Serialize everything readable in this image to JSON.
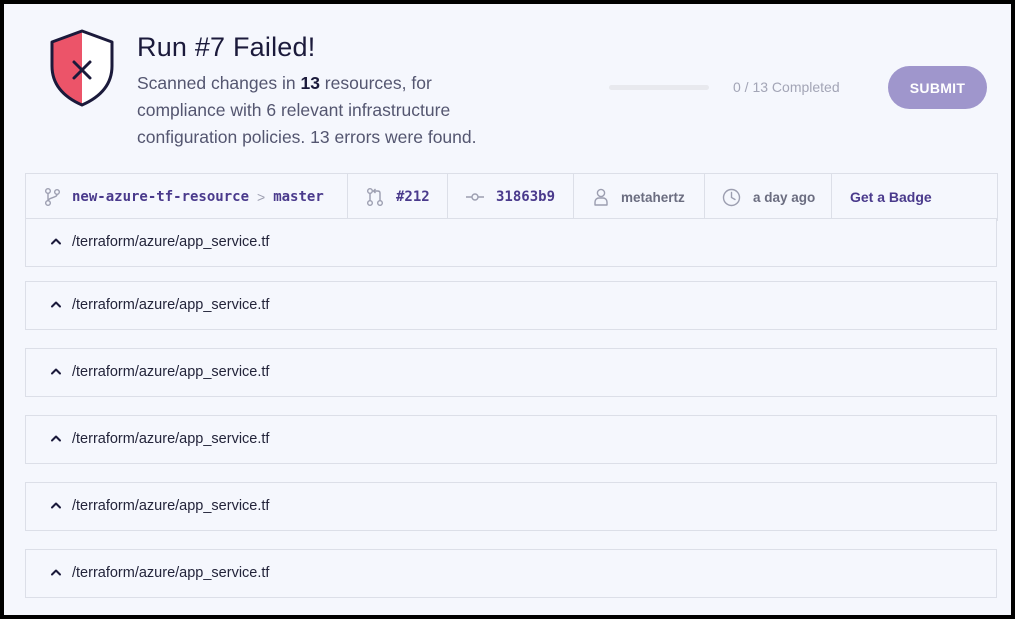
{
  "header": {
    "title": "Run #7 Failed!",
    "desc_prefix": "Scanned changes in ",
    "resource_count": "13",
    "desc_suffix": " resources, for compliance with 6 relevant infrastructure configuration policies. 13 errors were found.",
    "shield_icon": "shield-x-icon",
    "colors": {
      "danger": "#ec5469",
      "accent": "#9f96cc",
      "ink": "#1b1a3b"
    }
  },
  "progress": {
    "fraction": 0,
    "label": "0 / 13 Completed"
  },
  "submit": {
    "label": "SUBMIT"
  },
  "meta": {
    "repo": "new-azure-tf-resource",
    "separator": ">",
    "branch": "master",
    "pr": "#212",
    "commit": "31863b9",
    "user": "metahertz",
    "time": "a day ago",
    "badge": "Get a Badge"
  },
  "files": [
    {
      "path": "/terraform/azure/app_service.tf"
    },
    {
      "path": "/terraform/azure/app_service.tf"
    },
    {
      "path": "/terraform/azure/app_service.tf"
    },
    {
      "path": "/terraform/azure/app_service.tf"
    },
    {
      "path": "/terraform/azure/app_service.tf"
    },
    {
      "path": "/terraform/azure/app_service.tf"
    }
  ]
}
